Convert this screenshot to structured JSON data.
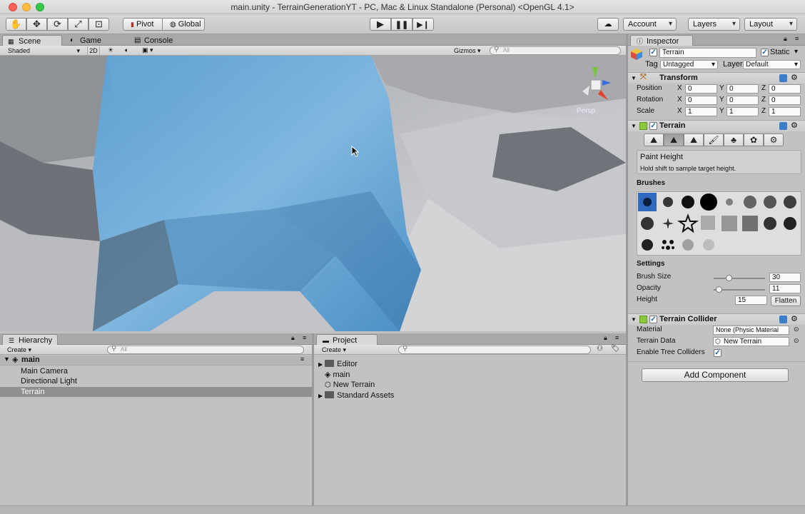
{
  "window": {
    "title": "main.unity - TerrainGenerationYT - PC, Mac & Linux Standalone (Personal) <OpenGL 4.1>"
  },
  "toolbar": {
    "tools": [
      "hand-icon",
      "move-icon",
      "rotate-icon",
      "scale-icon",
      "rect-icon"
    ],
    "pivot": "Pivot",
    "global": "Global",
    "account": "Account",
    "layers": "Layers",
    "layout": "Layout"
  },
  "scene": {
    "tabs": {
      "scene": "Scene",
      "game": "Game",
      "console": "Console"
    },
    "shading": "Shaded",
    "mode2d": "2D",
    "gizmos": "Gizmos",
    "search_placeholder": "All",
    "persp": "Persp"
  },
  "hierarchy": {
    "tab": "Hierarchy",
    "create": "Create",
    "search_placeholder": "All",
    "scene_name": "main",
    "items": [
      "Main Camera",
      "Directional Light",
      "Terrain"
    ],
    "selected": "Terrain"
  },
  "project": {
    "tab": "Project",
    "create": "Create",
    "items": [
      "Editor",
      "main",
      "New Terrain",
      "Standard Assets"
    ]
  },
  "inspector": {
    "tab": "Inspector",
    "object_name": "Terrain",
    "static_label": "Static",
    "tag_label": "Tag",
    "tag_value": "Untagged",
    "layer_label": "Layer",
    "layer_value": "Default",
    "transform": {
      "title": "Transform",
      "position_label": "Position",
      "rotation_label": "Rotation",
      "scale_label": "Scale",
      "position": [
        "0",
        "0",
        "0"
      ],
      "rotation": [
        "0",
        "0",
        "0"
      ],
      "scale": [
        "1",
        "1",
        "1"
      ],
      "x": "X",
      "y": "Y",
      "z": "Z"
    },
    "terrain": {
      "title": "Terrain",
      "tool_title": "Paint Height",
      "tool_hint": "Hold shift to sample target height.",
      "brushes_label": "Brushes",
      "settings_label": "Settings",
      "brush_size_label": "Brush Size",
      "brush_size": "30",
      "brush_size_fraction": 0.3,
      "opacity_label": "Opacity",
      "opacity": "11",
      "opacity_fraction": 0.11,
      "height_label": "Height",
      "height": "15",
      "flatten": "Flatten"
    },
    "collider": {
      "title": "Terrain Collider",
      "material_label": "Material",
      "material_value": "None (Physic Material",
      "data_label": "Terrain Data",
      "data_value": "New Terrain",
      "trees_label": "Enable Tree Colliders"
    },
    "add_component": "Add Component"
  },
  "colors": {
    "selection": "#8f8f8f",
    "accent": "#3d7cc9"
  }
}
